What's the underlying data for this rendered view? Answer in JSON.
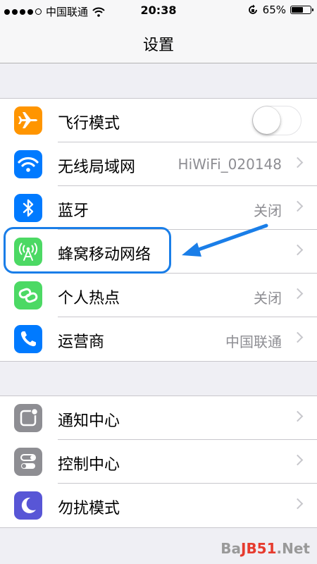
{
  "status_bar": {
    "carrier": "中国联通",
    "time": "20:38",
    "battery_percent": "65%",
    "battery_level": 0.65,
    "signal_bars": 4
  },
  "nav": {
    "title": "设置"
  },
  "group1": [
    {
      "label": "飞行模式",
      "icon": "airplane-icon",
      "color": "#ff9500",
      "toggle": false
    },
    {
      "label": "无线局域网",
      "value": "HiWiFi_020148",
      "icon": "wifi-icon",
      "color": "#007aff"
    },
    {
      "label": "蓝牙",
      "value": "关闭",
      "icon": "bluetooth-icon",
      "color": "#007aff"
    },
    {
      "label": "蜂窝移动网络",
      "value": "",
      "icon": "cellular-icon",
      "color": "#4cd964"
    },
    {
      "label": "个人热点",
      "value": "关闭",
      "icon": "hotspot-icon",
      "color": "#4cd964"
    },
    {
      "label": "运营商",
      "value": "中国联通",
      "icon": "phone-icon",
      "color": "#007aff"
    }
  ],
  "group2": [
    {
      "label": "通知中心",
      "icon": "notification-center-icon",
      "color": "#8e8e93"
    },
    {
      "label": "控制中心",
      "icon": "control-center-icon",
      "color": "#8e8e93"
    },
    {
      "label": "勿扰模式",
      "icon": "moon-icon",
      "color": "#5856d6"
    }
  ],
  "watermark": {
    "text_a": "Ba",
    "text_b": "JB51",
    "text_c": ".Net"
  },
  "annotation_color": "#1a7ee8"
}
